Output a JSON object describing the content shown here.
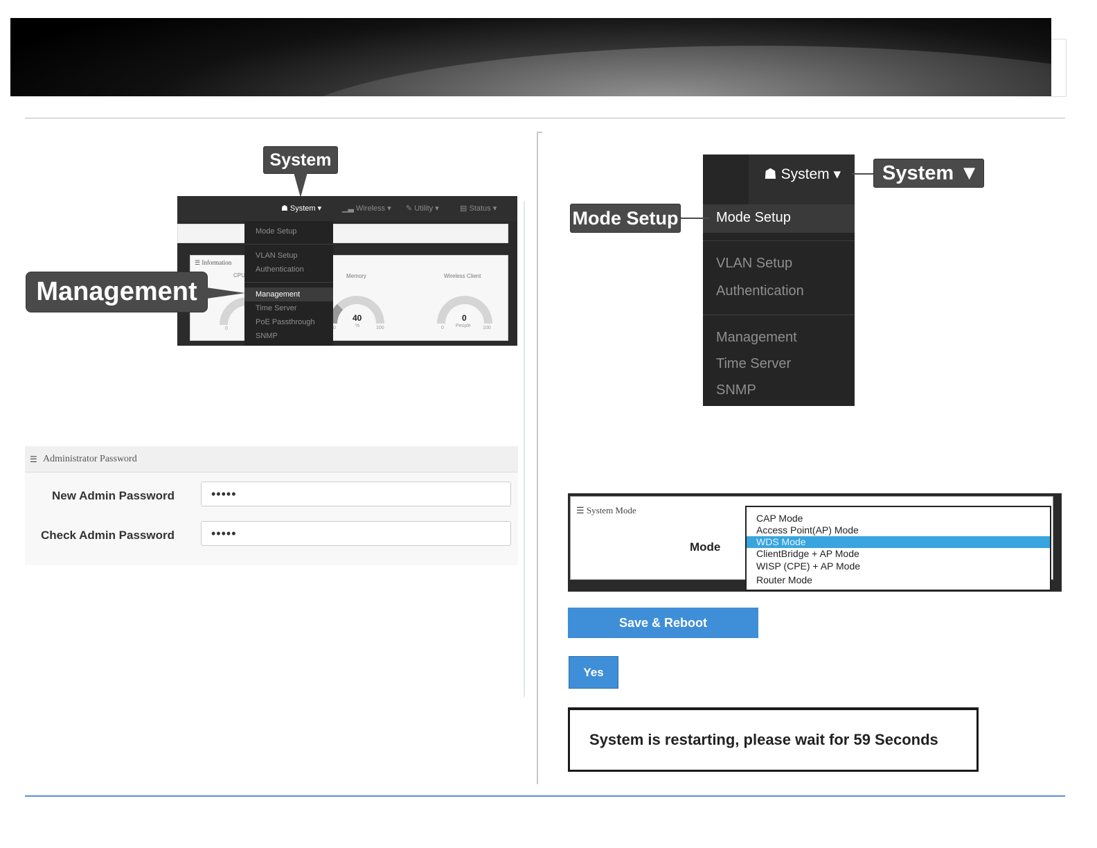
{
  "left": {
    "callout_system": "System",
    "callout_management": "Management",
    "dashboard": {
      "nav": {
        "system": "☗ System ▾",
        "wireless": "▁▃ Wireless ▾",
        "utility": "✎ Utility ▾",
        "status": "▤ Status ▾"
      },
      "info_title": "☰ Information",
      "gauges": [
        {
          "label": "CPU",
          "value": "",
          "unit": "",
          "min": "0",
          "max": ""
        },
        {
          "label": "Memory",
          "value": "40",
          "unit": "%",
          "min": "0",
          "max": "100"
        },
        {
          "label": "Wireless Client",
          "value": "0",
          "unit": "People",
          "min": "0",
          "max": "100"
        }
      ],
      "menu": [
        "Mode Setup",
        "VLAN Setup",
        "Authentication",
        "Management",
        "Time Server",
        "PoE Passthrough",
        "SNMP"
      ]
    },
    "admin": {
      "title": "Administrator Password",
      "new_label": "New Admin Password",
      "new_value": "•••••",
      "check_label": "Check Admin Password",
      "check_value": "•••••"
    }
  },
  "right": {
    "menu": {
      "system": "☗ System ▾",
      "items": [
        "Mode Setup",
        "VLAN Setup",
        "Authentication",
        "Management",
        "Time Server",
        "SNMP"
      ]
    },
    "callout_system": "System ▼",
    "callout_mode": "Mode Setup",
    "system_mode": {
      "title": "☰ System Mode",
      "mode_label": "Mode",
      "options": [
        "CAP Mode",
        "Access Point(AP) Mode",
        "WDS Mode",
        "ClientBridge + AP Mode",
        "WISP (CPE) + AP Mode",
        "Router Mode"
      ],
      "selected_index": 2
    },
    "save_button": "Save & Reboot",
    "yes_button": "Yes",
    "restart_message": "System is restarting, please wait for 59 Seconds"
  },
  "colors": {
    "accent": "#3e8ed8",
    "highlight": "#38a5de",
    "menu_bg": "#252525",
    "callout": "#4a4a4a"
  }
}
